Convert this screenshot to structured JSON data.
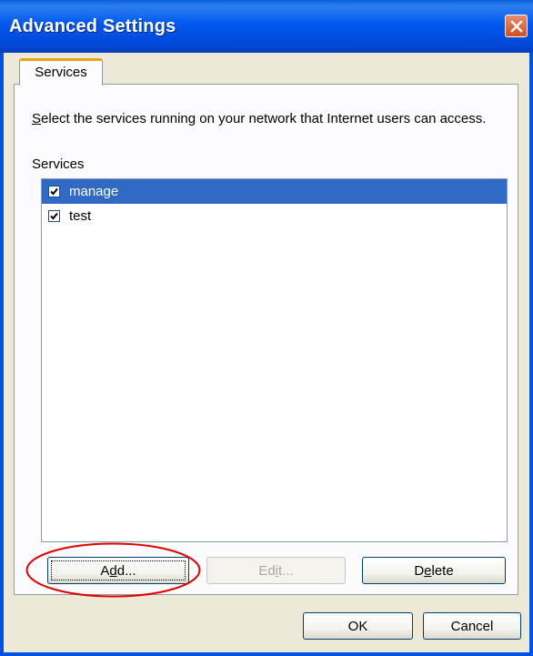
{
  "window": {
    "title": "Advanced Settings",
    "close_icon": "close-icon",
    "titlebar_color": "#0058ee"
  },
  "tab": {
    "label": "Services"
  },
  "description": {
    "mnemonic": "S",
    "text": "elect the services running on your network that Internet users can access."
  },
  "services_label": "Services",
  "services": [
    {
      "label": "manage",
      "checked": true,
      "selected": true
    },
    {
      "label": "test",
      "checked": true,
      "selected": false
    }
  ],
  "buttons": {
    "add": {
      "before": "A",
      "mnemonic": "d",
      "after": "d..."
    },
    "edit": {
      "before": "Ed",
      "mnemonic": "i",
      "after": "t..."
    },
    "delete": {
      "before": "D",
      "mnemonic": "e",
      "after": "lete"
    },
    "ok": "OK",
    "cancel": "Cancel"
  },
  "colors": {
    "selection": "#316ac5",
    "annotation_ellipse": "#e00000"
  }
}
